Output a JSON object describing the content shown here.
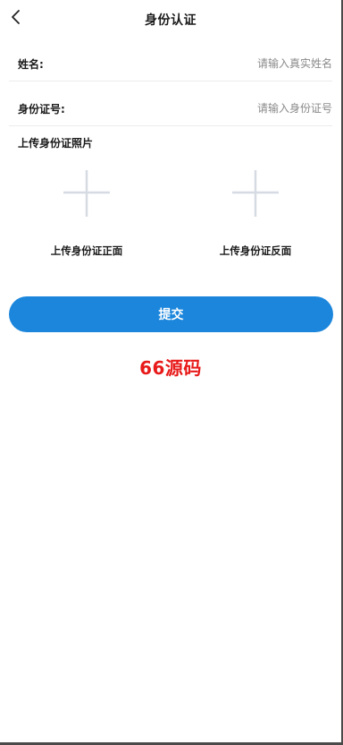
{
  "header": {
    "title": "身份认证",
    "back_icon": "chevron-left-icon"
  },
  "form": {
    "name_label": "姓名:",
    "name_placeholder": "请输入真实姓名",
    "idnum_label": "身份证号:",
    "idnum_placeholder": "请输入身份证号"
  },
  "upload": {
    "section_title": "上传身份证照片",
    "front_label": "上传身份证正面",
    "back_label": "上传身份证反面",
    "icon": "plus-icon"
  },
  "submit_label": "提交",
  "watermark": "66源码",
  "colors": {
    "primary": "#1b86dc",
    "watermark": "#e81a1a",
    "plus": "#d6dbe3",
    "placeholder": "#8a8a8a"
  }
}
